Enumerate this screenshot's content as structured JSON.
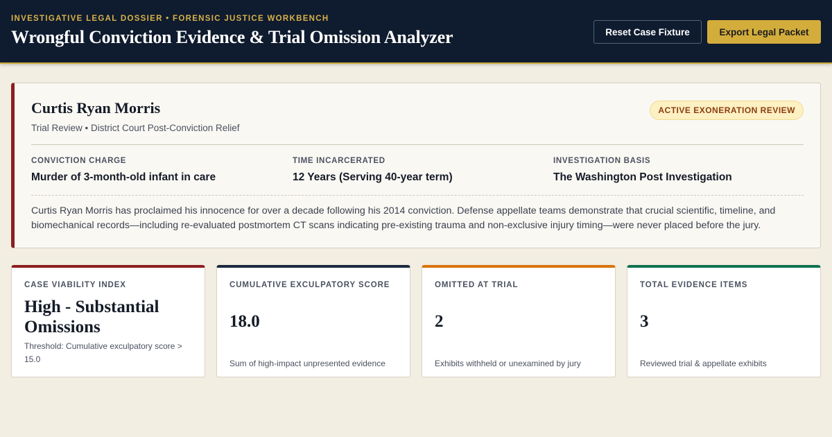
{
  "header": {
    "eyebrow": "INVESTIGATIVE LEGAL DOSSIER • FORENSIC JUSTICE WORKBENCH",
    "title": "Wrongful Conviction Evidence & Trial Omission Analyzer",
    "reset_label": "Reset Case Fixture",
    "export_label": "Export Legal Packet"
  },
  "case": {
    "name": "Curtis Ryan Morris",
    "subtitle": "Trial Review • District Court Post-Conviction Relief",
    "badge": "ACTIVE EXONERATION REVIEW",
    "facts": [
      {
        "label": "CONVICTION CHARGE",
        "value": "Murder of 3-month-old infant in care"
      },
      {
        "label": "TIME INCARCERATED",
        "value": "12 Years (Serving 40-year term)"
      },
      {
        "label": "INVESTIGATION BASIS",
        "value": "The Washington Post Investigation"
      }
    ],
    "description": "Curtis Ryan Morris has proclaimed his innocence for over a decade following his 2014 conviction. Defense appellate teams demonstrate that crucial scientific, timeline, and biomechanical records—including re-evaluated postmortem CT scans indicating pre-existing trauma and non-exclusive injury timing—were never placed before the jury."
  },
  "stats": [
    {
      "label": "CASE VIABILITY INDEX",
      "value": "High - Substantial Omissions",
      "note": "Threshold: Cumulative exculpatory score > 15.0",
      "accent": "#8c1f1f"
    },
    {
      "label": "CUMULATIVE EXCULPATORY SCORE",
      "value": "18.0",
      "note": "Sum of high-impact unpresented evidence",
      "accent": "#1e2a3e"
    },
    {
      "label": "OMITTED AT TRIAL",
      "value": "2",
      "note": "Exhibits withheld or unexamined by jury",
      "accent": "#d9740f"
    },
    {
      "label": "TOTAL EVIDENCE ITEMS",
      "value": "3",
      "note": "Reviewed trial & appellate exhibits",
      "accent": "#0f7350"
    }
  ],
  "colors": {
    "header_bg": "#0f1b2e",
    "gold_accent": "#d3ad3c",
    "case_accent": "#8c1f1f",
    "page_bg": "#f3eee2"
  }
}
